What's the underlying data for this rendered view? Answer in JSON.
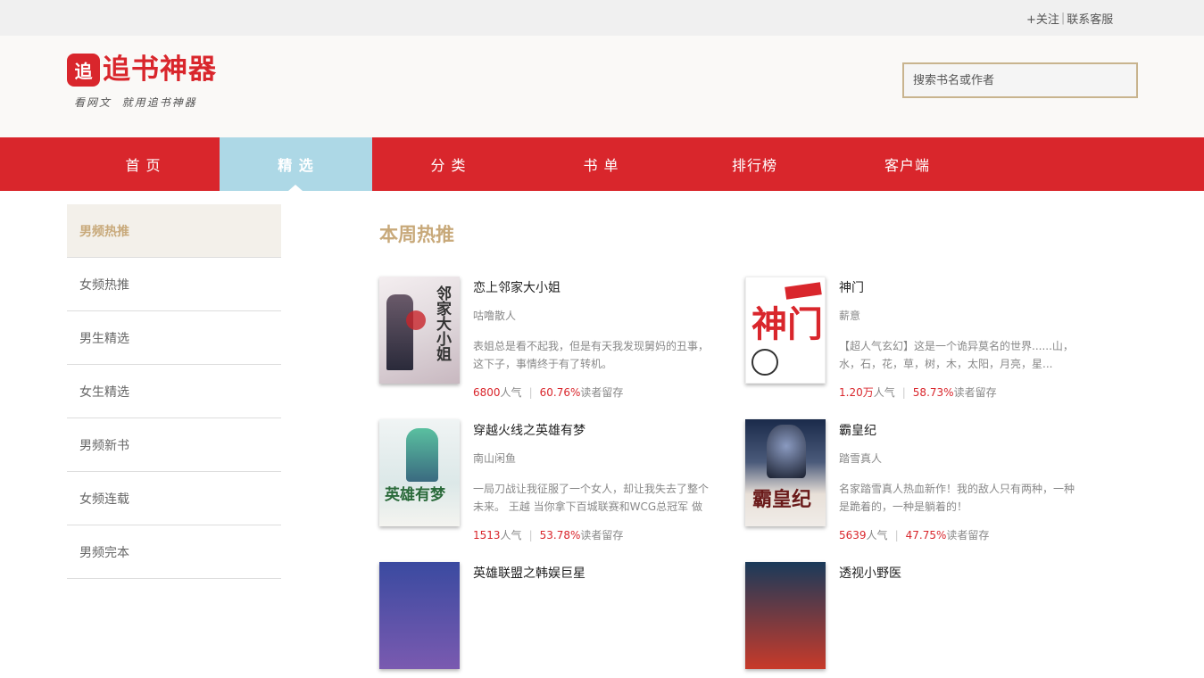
{
  "topbar": {
    "follow": "+关注",
    "service": "联系客服"
  },
  "logo": {
    "badge": "追",
    "name": "追书神器",
    "tagline": "看网文  就用追书神器"
  },
  "search": {
    "placeholder": "搜索书名或作者"
  },
  "nav": [
    {
      "label": "首 页"
    },
    {
      "label": "精 选"
    },
    {
      "label": "分 类"
    },
    {
      "label": "书 单"
    },
    {
      "label": "排行榜"
    },
    {
      "label": "客户端"
    }
  ],
  "sidebar": [
    {
      "label": "男频热推"
    },
    {
      "label": "女频热推"
    },
    {
      "label": "男生精选"
    },
    {
      "label": "女生精选"
    },
    {
      "label": "男频新书"
    },
    {
      "label": "女频连载"
    },
    {
      "label": "男频完本"
    }
  ],
  "section_title": "本周热推",
  "books": [
    {
      "title": "恋上邻家大小姐",
      "author": "咕噜散人",
      "desc": "表姐总是看不起我，但是有天我发现舅妈的丑事，这下子，事情终于有了转机。",
      "popularity": "6800",
      "pop_label": "人气",
      "retention": "60.76%",
      "ret_label": "读者留存",
      "cover_text": "邻家大小姐",
      "cover_color": "#e8e4e8"
    },
    {
      "title": "神门",
      "author": "薪意",
      "desc": "【超人气玄幻】这是一个诡异莫名的世界......山，水，石，花，草，树，木，太阳，月亮，星...",
      "popularity": "1.20万",
      "pop_label": "人气",
      "retention": "58.73%",
      "ret_label": "读者留存",
      "cover_text": "神门",
      "cover_color": "#ffffff"
    },
    {
      "title": "穿越火线之英雄有梦",
      "author": "南山闲鱼",
      "desc": "一局刀战让我征服了一个女人，却让我失去了整个未来。 王越 当你拿下百城联赛和WCG总冠军 做到...",
      "popularity": "1513",
      "pop_label": "人气",
      "retention": "53.78%",
      "ret_label": "读者留存",
      "cover_text": "英雄有梦",
      "cover_color": "#e6eef0"
    },
    {
      "title": "霸皇纪",
      "author": "踏雪真人",
      "desc": "名家踏雪真人热血新作！我的敌人只有两种，一种是跪着的，一种是躺着的！",
      "popularity": "5639",
      "pop_label": "人气",
      "retention": "47.75%",
      "ret_label": "读者留存",
      "cover_text": "霸皇纪",
      "cover_color": "#3a4a6a"
    },
    {
      "title": "英雄联盟之韩娱巨星",
      "author": "",
      "desc": "",
      "popularity": "",
      "pop_label": "",
      "retention": "",
      "ret_label": "",
      "cover_text": "",
      "cover_color": "#4a5aa0"
    },
    {
      "title": "透视小野医",
      "author": "",
      "desc": "",
      "popularity": "",
      "pop_label": "",
      "retention": "",
      "ret_label": "",
      "cover_text": "",
      "cover_color": "#2a3a5a"
    }
  ]
}
